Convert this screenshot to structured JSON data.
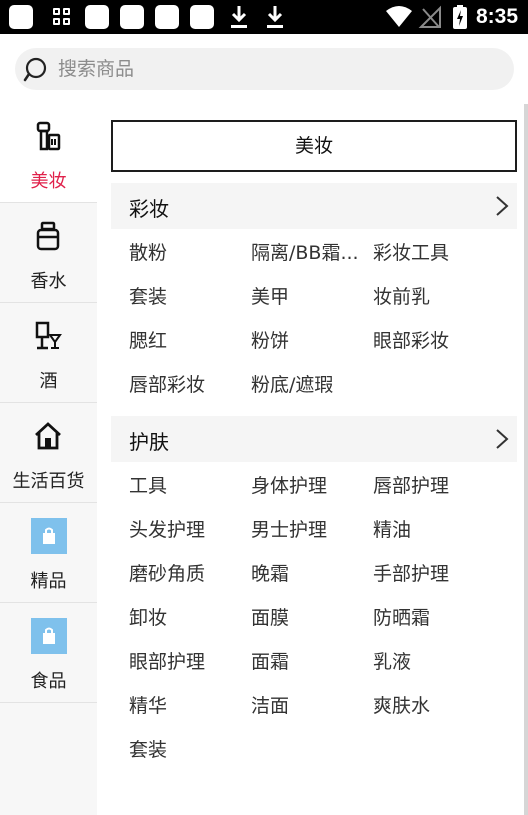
{
  "status_bar": {
    "time": "8:35",
    "left_icons": [
      "app-notification-icon",
      "grid-app-icon",
      "app-notification-icon",
      "app-notification-icon",
      "app-notification-icon",
      "app-notification-icon",
      "download-icon",
      "download-icon"
    ],
    "right_icons": [
      "wifi-icon",
      "no-signal-icon",
      "battery-charging-icon"
    ]
  },
  "search": {
    "placeholder": "搜索商品"
  },
  "sidebar": {
    "items": [
      {
        "label": "美妆",
        "icon": "cosmetics-icon",
        "active": true
      },
      {
        "label": "香水",
        "icon": "perfume-icon",
        "active": false
      },
      {
        "label": "酒",
        "icon": "wine-icon",
        "active": false
      },
      {
        "label": "生活百货",
        "icon": "home-icon",
        "active": false
      },
      {
        "label": "精品",
        "icon": "shopping-bag-icon",
        "active": false
      },
      {
        "label": "食品",
        "icon": "shopping-bag-icon",
        "active": false
      }
    ]
  },
  "content": {
    "banner": "美妆",
    "sections": [
      {
        "title": "彩妆",
        "items": [
          "散粉",
          "隔离/BB霜...",
          "彩妆工具",
          "套装",
          "美甲",
          "妆前乳",
          "腮红",
          "粉饼",
          "眼部彩妆",
          "唇部彩妆",
          "粉底/遮瑕"
        ]
      },
      {
        "title": "护肤",
        "items": [
          "工具",
          "身体护理",
          "唇部护理",
          "头发护理",
          "男士护理",
          "精油",
          "磨砂角质",
          "晚霜",
          "手部护理",
          "卸妆",
          "面膜",
          "防晒霜",
          "眼部护理",
          "面霜",
          "乳液",
          "精华",
          "洁面",
          "爽肤水",
          "套装"
        ]
      }
    ]
  },
  "colors": {
    "active": "#e0204a",
    "sidebar_bg": "#f7f7f7",
    "section_bg": "#f5f5f5",
    "bag_icon": "#7fc1ec"
  }
}
